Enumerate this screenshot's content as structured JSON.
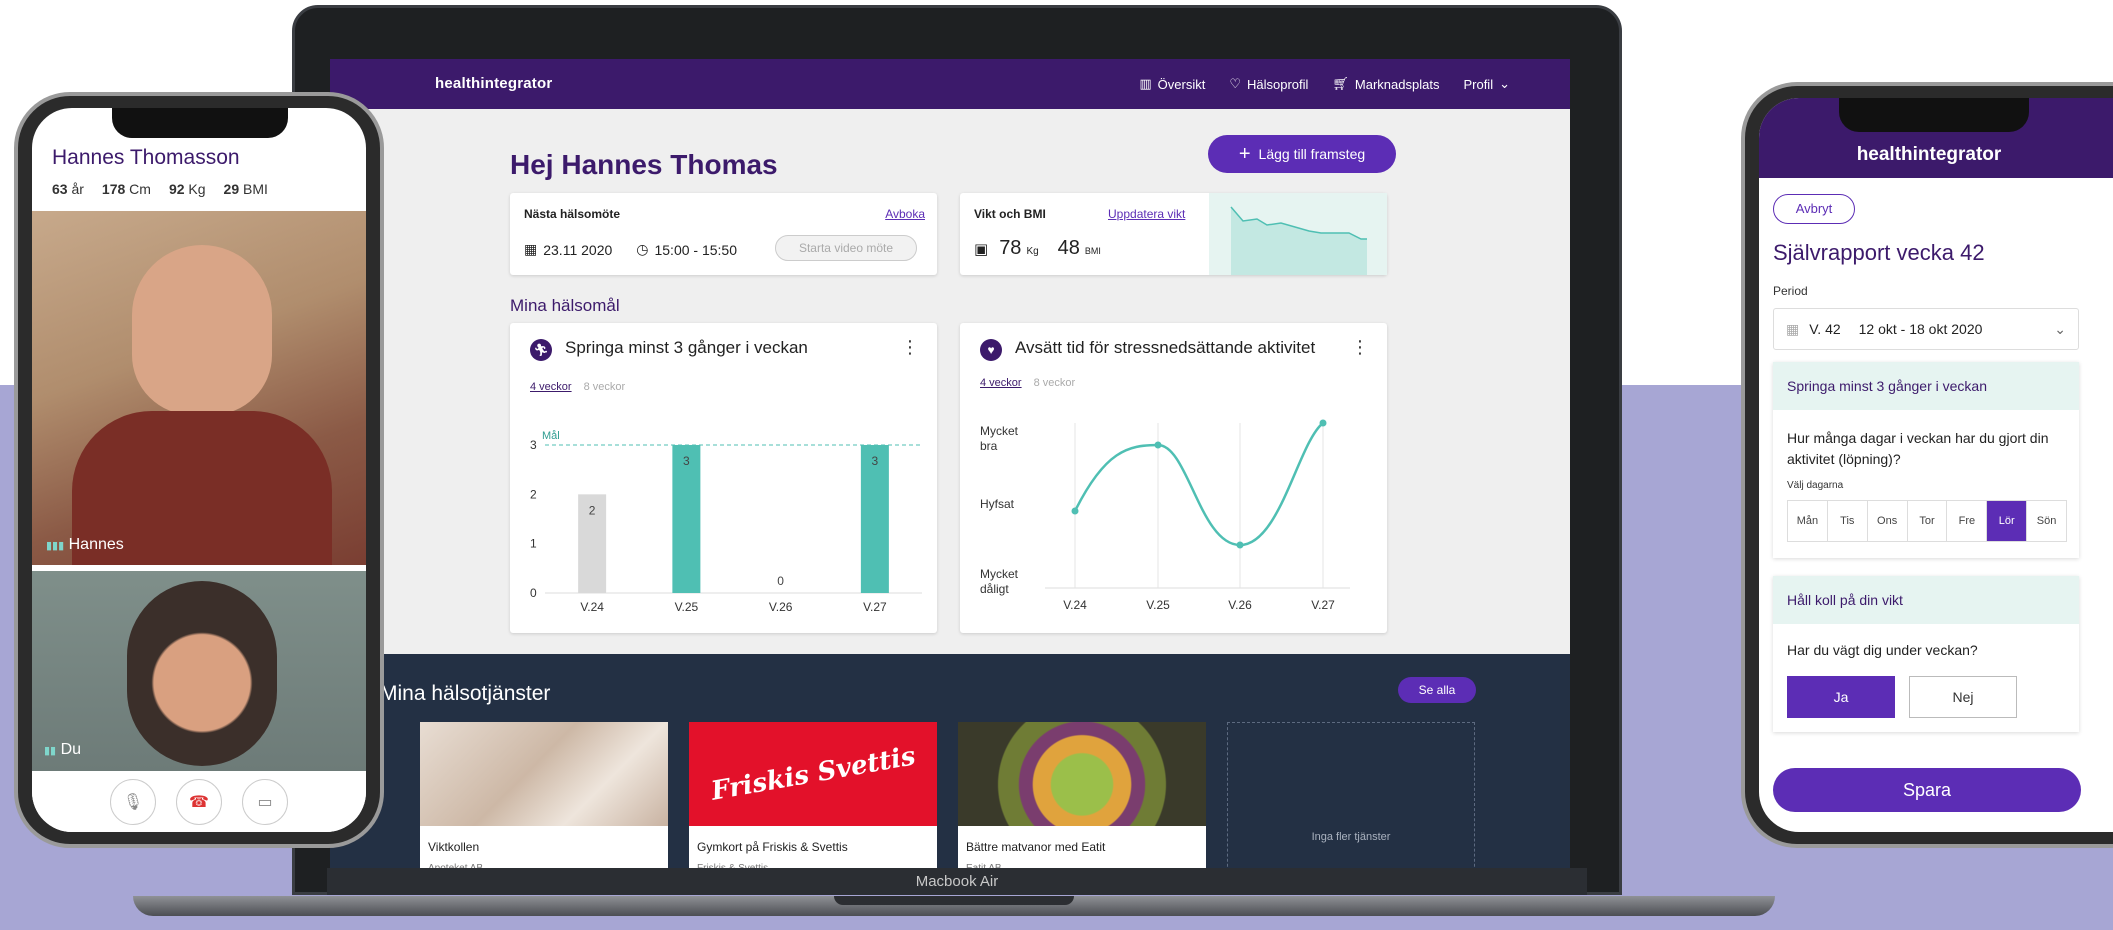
{
  "brand": "healthintegrator",
  "nav": {
    "items": [
      "Översikt",
      "Hälsoprofil",
      "Marknadsplats",
      "Profil"
    ]
  },
  "dashboard": {
    "greeting": "Hej Hannes Thomas",
    "add_button": "Lägg till framsteg",
    "meeting": {
      "label": "Nästa hälsomöte",
      "link": "Avboka",
      "date": "23.11 2020",
      "time": "15:00 - 15:50",
      "video_button": "Starta video möte"
    },
    "weight": {
      "label": "Vikt och BMI",
      "link": "Uppdatera vikt",
      "kg_value": "78",
      "kg_unit": "Kg",
      "bmi_value": "48",
      "bmi_unit": "BMI"
    },
    "goals_title": "Mina hälsomål",
    "goal1": {
      "title": "Springa minst 3 gånger i veckan",
      "tab1": "4 veckor",
      "tab2": "8 veckor"
    },
    "goal2": {
      "title": "Avsätt tid för stressnedsättande aktivitet",
      "tab1": "4 veckor",
      "tab2": "8 veckor"
    }
  },
  "chart_data": [
    {
      "type": "bar",
      "categories": [
        "V.24",
        "V.25",
        "V.26",
        "V.27"
      ],
      "values": [
        2,
        3,
        0,
        3
      ],
      "ylim": [
        0,
        3
      ],
      "yticks": [
        "0",
        "1",
        "2",
        "3"
      ],
      "target_label": "Mål",
      "target": 3,
      "colors": [
        "#d9d9d9",
        "#4fbfb3",
        "#4fbfb3",
        "#4fbfb3"
      ]
    },
    {
      "type": "line",
      "categories": [
        "V.24",
        "V.25",
        "V.26",
        "V.27"
      ],
      "values": [
        1,
        1.7,
        0.5,
        2
      ],
      "ylabels": [
        "Mycket dåligt",
        "Hyfsat",
        "Mycket bra"
      ],
      "color": "#4fbfb3"
    }
  ],
  "services": {
    "title": "Mina hälsotjänster",
    "see_all": "Se alla",
    "items": [
      {
        "title": "Viktkollen",
        "subtitle": "Apoteket AB"
      },
      {
        "title": "Gymkort på Friskis & Svettis",
        "subtitle": "Friskis & Svettis",
        "logo": "Friskis Svettis"
      },
      {
        "title": "Bättre matvanor med Eatit",
        "subtitle": "Eatit AB"
      }
    ],
    "empty": "Inga fler tjänster"
  },
  "laptop_label": "Macbook Air",
  "left_phone": {
    "name": "Hannes Thomasson",
    "stats": [
      {
        "v": "63",
        "u": "år"
      },
      {
        "v": "178",
        "u": "Cm"
      },
      {
        "v": "92",
        "u": "Kg"
      },
      {
        "v": "29",
        "u": "BMI"
      }
    ],
    "caller": "Hannes",
    "self": "Du"
  },
  "right_phone": {
    "cancel": "Avbryt",
    "title": "Självrapport vecka 42",
    "period_label": "Period",
    "week": "V. 42",
    "range": "12 okt - 18 okt 2020",
    "q1_header": "Springa minst 3 gånger i veckan",
    "q1_text": "Hur många dagar i veckan har du gjort din aktivitet (löpning)?",
    "q1_hint": "Välj dagarna",
    "days": [
      "Mån",
      "Tis",
      "Ons",
      "Tor",
      "Fre",
      "Lör",
      "Sön"
    ],
    "q2_header": "Håll koll på din vikt",
    "q2_text": "Har du vägt dig under veckan?",
    "yes": "Ja",
    "no": "Nej",
    "save": "Spara"
  }
}
